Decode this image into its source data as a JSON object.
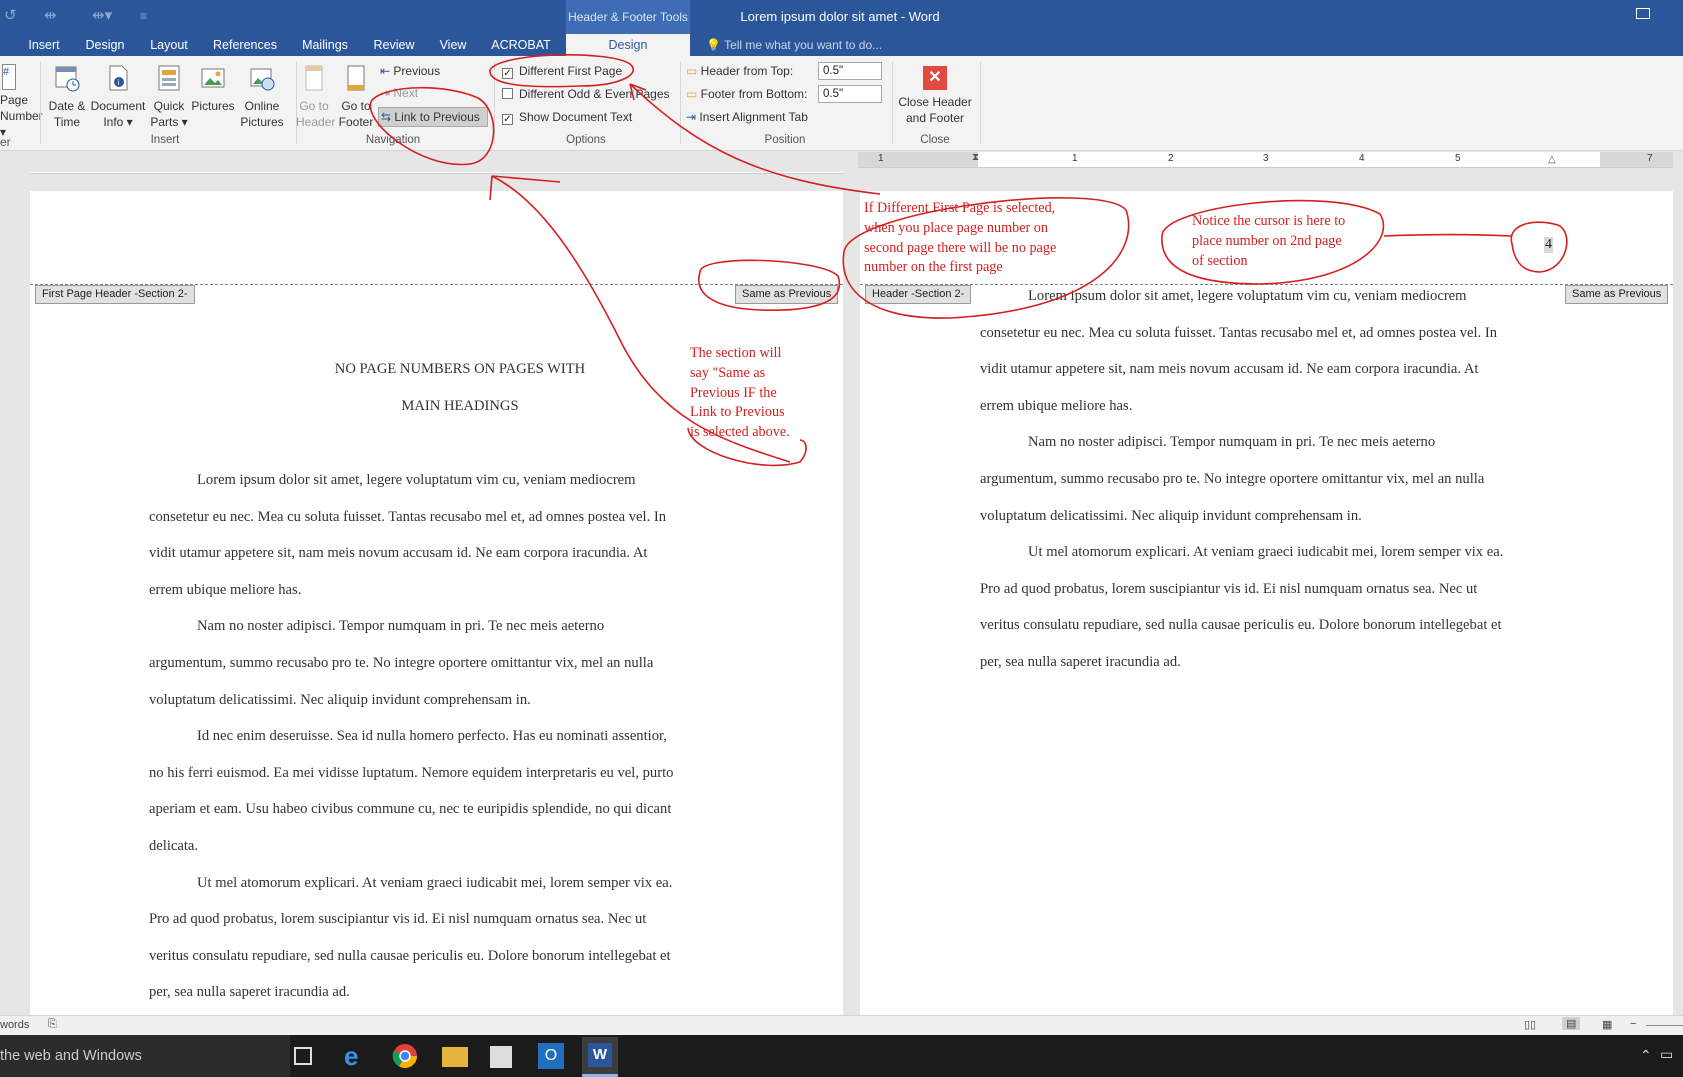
{
  "window": {
    "title": "Lorem ipsum dolor sit amet - Word",
    "contextual_group": "Header & Footer Tools"
  },
  "tabs": [
    "Insert",
    "Design",
    "Layout",
    "References",
    "Mailings",
    "Review",
    "View",
    "ACROBAT"
  ],
  "active_tab": "Design",
  "tell_me": "Tell me what you want to do...",
  "ribbon": {
    "page_number": [
      "Page",
      "Number"
    ],
    "insert_group": {
      "label": "Insert",
      "date_time": [
        "Date &",
        "Time"
      ],
      "document_info": [
        "Document",
        "Info"
      ],
      "quick_parts": [
        "Quick",
        "Parts"
      ],
      "pictures": "Pictures",
      "online_pictures": [
        "Online",
        "Pictures"
      ]
    },
    "navigation_group": {
      "label": "Navigation",
      "go_to_header": [
        "Go to",
        "Header"
      ],
      "go_to_footer": [
        "Go to",
        "Footer"
      ],
      "previous": "Previous",
      "next": "Next",
      "link_to_previous": "Link to Previous"
    },
    "options_group": {
      "label": "Options",
      "different_first_page": "Different First Page",
      "different_odd_even": "Different Odd & Even Pages",
      "show_document_text": "Show Document Text"
    },
    "position_group": {
      "label": "Position",
      "header_from_top": "Header from Top:",
      "header_from_top_value": "0.5\"",
      "footer_from_bottom": "Footer from Bottom:",
      "footer_from_bottom_value": "0.5\"",
      "insert_alignment_tab": "Insert Alignment Tab"
    },
    "close_group": {
      "label": "Close",
      "close_header_footer": [
        "Close Header",
        "and Footer"
      ]
    }
  },
  "ruler": {
    "numbers": [
      "1",
      "1",
      "2",
      "3",
      "4",
      "5",
      "7"
    ]
  },
  "left_page": {
    "header_tag": "First Page Header -Section 2-",
    "same_as_previous": "Same as Previous",
    "heading": [
      "NO PAGE NUMBERS ON PAGES WITH",
      "MAIN HEADINGS"
    ],
    "lines": [
      "Lorem ipsum dolor sit amet, legere voluptatum vim cu, veniam mediocrem",
      "consetetur eu nec. Mea cu soluta fuisset. Tantas recusabo mel et, ad omnes postea vel. In",
      "vidit utamur appetere sit, nam meis novum accusam id. Ne eam corpora iracundia. At",
      "errem ubique meliore has.",
      "Nam no noster adipisci. Tempor numquam in pri. Te nec meis aeterno",
      "argumentum, summo recusabo pro te. No integre oportere omittantur vix, mel an nulla",
      "voluptatum delicatissimi. Nec aliquip invidunt comprehensam in.",
      "Id nec enim deseruisse. Sea id nulla homero perfecto. Has eu nominati assentior,",
      "no his ferri euismod. Ea mei vidisse luptatum. Nemore equidem interpretaris eu vel, purto",
      "aperiam et eam. Usu habeo civibus commune cu, nec te euripidis splendide, no qui dicant",
      "delicata.",
      "Ut mel atomorum explicari. At veniam graeci iudicabit mei, lorem semper vix ea.",
      "Pro ad quod probatus, lorem suscipiantur vis id. Ei nisl numquam ornatus sea. Nec ut",
      "veritus consulatu repudiare, sed nulla causae periculis eu. Dolore bonorum intellegebat et",
      "per, sea nulla saperet iracundia ad."
    ]
  },
  "right_page": {
    "header_tag": "Header -Section 2-",
    "same_as_previous": "Same as Previous",
    "page_number_cursor": "4",
    "lines": [
      "Lorem ipsum dolor sit amet, legere voluptatum vim cu, veniam mediocrem",
      "consetetur eu nec. Mea cu soluta fuisset. Tantas recusabo mel et, ad omnes postea vel. In",
      "vidit utamur appetere sit, nam meis novum accusam id. Ne eam corpora iracundia. At",
      "errem ubique meliore has.",
      "Nam no noster adipisci. Tempor numquam in pri. Te nec meis aeterno",
      "argumentum, summo recusabo pro te. No integre oportere omittantur vix, mel an nulla",
      "voluptatum delicatissimi. Nec aliquip invidunt comprehensam in.",
      "Ut mel atomorum explicari. At veniam graeci iudicabit mei, lorem semper vix ea.",
      "Pro ad quod probatus, lorem suscipiantur vis id. Ei nisl numquam ornatus sea. Nec ut",
      "veritus consulatu repudiare, sed nulla causae periculis eu. Dolore bonorum intellegebat et",
      "per, sea nulla saperet iracundia ad."
    ]
  },
  "annotations": {
    "different_first_page": [
      "If Different First Page is selected,",
      "when you place page number on",
      "second page there will be no page",
      "number on the first page"
    ],
    "cursor_note": [
      "Notice the cursor is here to",
      "place number on 2nd page",
      "of section"
    ],
    "same_as_previous_note": [
      "The section will",
      "say \"Same as",
      "Previous IF the",
      "Link to Previous",
      "is selected above."
    ]
  },
  "status_bar": {
    "words": "words"
  },
  "taskbar": {
    "search": "the web and Windows"
  },
  "colors": {
    "word_blue": "#2b579a",
    "annotation_red": "#d42020",
    "close_red": "#e04a3f"
  }
}
